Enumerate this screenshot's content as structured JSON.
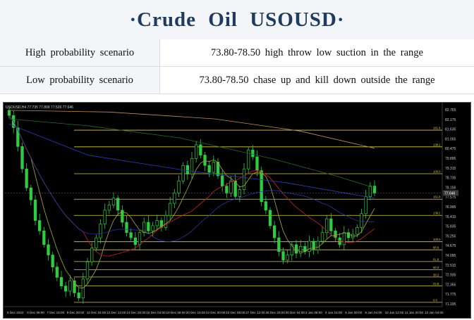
{
  "title": "·Crude   Oil   USOUSD·",
  "scenarios": [
    {
      "label": "High probability scenario",
      "value": "73.80-78.50  high  throw  low  suction  in  the  range"
    },
    {
      "label": "Low probability scenario",
      "value": "73.80-78.50  chase  up  and  kill  down  outside  the  range"
    }
  ],
  "chart_data": {
    "type": "candlestick",
    "header": "USOUSD,H4  77.735  77.899  77.526  77.646",
    "colors": {
      "candle": "#2ecc40",
      "fib": "#d9cc4a",
      "ma_red": "#b22222",
      "ma_olive": "#9a9a36",
      "ma_tan": "#b89060",
      "ma_blue": "#2a3fb0",
      "ma_green": "#2a6a2a"
    },
    "ylim": [
      71.0,
      82.6
    ],
    "price_ticks": [
      "82.755",
      "82.175",
      "81.635",
      "81.055",
      "80.475",
      "79.895",
      "79.315",
      "78.735",
      "78.155",
      "77.575",
      "76.995",
      "76.415",
      "75.835",
      "75.255",
      "74.675",
      "74.095",
      "73.515",
      "72.935",
      "72.355",
      "71.775",
      "71.195"
    ],
    "fib_levels": [
      {
        "label": "161.8",
        "price": 81.25
      },
      {
        "label": "138.2",
        "price": 80.28
      },
      {
        "label": "100.0",
        "price": 78.72
      },
      {
        "label": "161.8",
        "price": 77.24
      },
      {
        "label": "138.2",
        "price": 76.3
      },
      {
        "label": "100.0",
        "price": 74.77
      },
      {
        "label": "88.6",
        "price": 74.3
      },
      {
        "label": "61.8",
        "price": 73.62
      },
      {
        "label": "50.0",
        "price": 73.15
      },
      {
        "label": "38.2",
        "price": 72.72
      },
      {
        "label": "23.6",
        "price": 72.2
      },
      {
        "label": "0.0",
        "price": 71.25
      }
    ],
    "current_price": "77.646",
    "x_labels": [
      "5 Dec 2022",
      "6 Dec 08:00",
      "7 Dec 16:00",
      "9 Dec 00:00",
      "12 Dec 04:00",
      "13 Dec 12:00",
      "14 Dec 20:00",
      "16 Dec 04:00",
      "19 Dec 08:00",
      "20 Dec 16:00",
      "22 Dec 00:00",
      "23 Dec 08:00",
      "27 Dec 12:00",
      "28 Dec 20:00",
      "30 Dec 04:00",
      "3 Jan 08:00",
      "4 Jan 16:00",
      "6 Jan 00:00",
      "9 Jan 04:00",
      "10 Jan 12:00",
      "11 Jan 20:00",
      "13 Jan 04:00"
    ],
    "closes": [
      82.1,
      81.4,
      80.3,
      79.0,
      77.9,
      77.2,
      76.0,
      75.4,
      74.6,
      74.0,
      73.3,
      72.7,
      72.2,
      71.9,
      72.5,
      71.8,
      71.5,
      72.6,
      73.6,
      74.4,
      75.0,
      75.8,
      76.6,
      76.9,
      77.3,
      76.6,
      75.9,
      75.3,
      75.0,
      74.6,
      75.3,
      75.9,
      75.4,
      75.7,
      76.0,
      75.6,
      76.3,
      77.0,
      77.6,
      78.3,
      79.2,
      78.7,
      79.6,
      80.4,
      79.8,
      79.2,
      78.8,
      79.4,
      78.6,
      78.0,
      77.6,
      78.3,
      77.4,
      77.8,
      79.0,
      80.1,
      79.7,
      78.9,
      77.1,
      76.6,
      75.7,
      75.0,
      74.2,
      73.7,
      74.0,
      74.6,
      74.1,
      74.5,
      74.2,
      74.8,
      74.3,
      74.8,
      75.3,
      76.1,
      75.4,
      75.0,
      74.6,
      75.3,
      75.0,
      75.2,
      75.6,
      76.4,
      77.4,
      78.0,
      77.6
    ]
  }
}
